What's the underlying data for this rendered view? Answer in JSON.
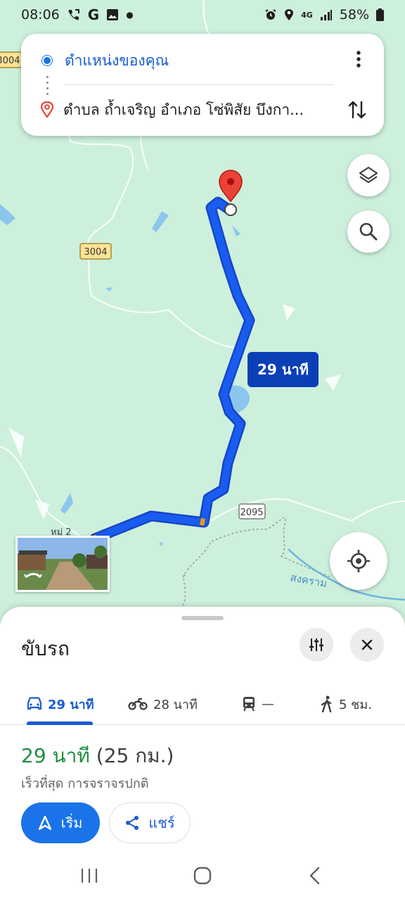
{
  "status_bar": {
    "time": "08:06",
    "network": "4G",
    "battery": "58%"
  },
  "route": {
    "origin": "ตำแหน่งของคุณ",
    "destination": "ตำบล ถ้ำเจริญ อำเภอ โซ่พิสัย บึงกา..."
  },
  "map": {
    "road_labels": [
      "3004",
      "3004",
      "2095"
    ],
    "place_labels": [
      "หมู่ 2",
      "สงคราม"
    ],
    "route_eta": "29 นาที",
    "route_color": "#1a5cf0"
  },
  "sheet": {
    "title": "ขับรถ",
    "modes": [
      {
        "icon": "car-icon",
        "label": "29 นาที",
        "active": true
      },
      {
        "icon": "motorcycle-icon",
        "label": "28 นาที",
        "active": false
      },
      {
        "icon": "train-icon",
        "label": "—",
        "active": false
      },
      {
        "icon": "walk-icon",
        "label": "5 ชม.",
        "active": false
      }
    ],
    "duration": "29 นาที",
    "distance": "(25 กม.)",
    "subtitle": "เร็วที่สุด การจราจรปกติ",
    "start_label": "เริ่ม",
    "share_label": "แชร์"
  },
  "colors": {
    "accent": "#1a73e8",
    "duration_green": "#1e8e3e",
    "map_background": "#cdf0dc"
  }
}
